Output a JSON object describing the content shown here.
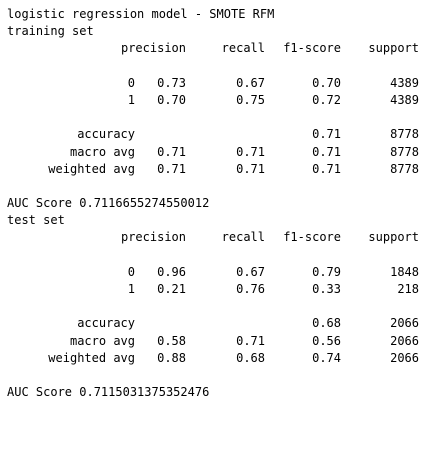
{
  "title": "logistic regression model - SMOTE RFM",
  "columns": [
    "precision",
    "recall",
    "f1-score",
    "support"
  ],
  "training": {
    "heading": "training set",
    "classes": [
      {
        "label": "0",
        "precision": "0.73",
        "recall": "0.67",
        "f1": "0.70",
        "support": "4389"
      },
      {
        "label": "1",
        "precision": "0.70",
        "recall": "0.75",
        "f1": "0.72",
        "support": "4389"
      }
    ],
    "accuracy": {
      "label": "accuracy",
      "f1": "0.71",
      "support": "8778"
    },
    "macro": {
      "label": "macro avg",
      "precision": "0.71",
      "recall": "0.71",
      "f1": "0.71",
      "support": "8778"
    },
    "weighted": {
      "label": "weighted avg",
      "precision": "0.71",
      "recall": "0.71",
      "f1": "0.71",
      "support": "8778"
    },
    "auc": "AUC Score 0.7116655274550012"
  },
  "test": {
    "heading": "test set",
    "classes": [
      {
        "label": "0",
        "precision": "0.96",
        "recall": "0.67",
        "f1": "0.79",
        "support": "1848"
      },
      {
        "label": "1",
        "precision": "0.21",
        "recall": "0.76",
        "f1": "0.33",
        "support": "218"
      }
    ],
    "accuracy": {
      "label": "accuracy",
      "f1": "0.68",
      "support": "2066"
    },
    "macro": {
      "label": "macro avg",
      "precision": "0.58",
      "recall": "0.71",
      "f1": "0.56",
      "support": "2066"
    },
    "weighted": {
      "label": "weighted avg",
      "precision": "0.88",
      "recall": "0.68",
      "f1": "0.74",
      "support": "2066"
    },
    "auc": "AUC Score 0.7115031375352476"
  }
}
